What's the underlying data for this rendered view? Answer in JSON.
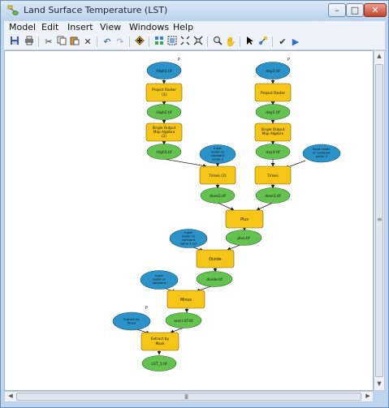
{
  "window": {
    "title": "Land Surface Temperature (LST)"
  },
  "menu": [
    "Model",
    "Edit",
    "Insert",
    "View",
    "Windows",
    "Help"
  ],
  "toolbar": [
    "save-icon",
    "print-icon",
    "cut-icon",
    "copy-icon",
    "paste-icon",
    "delete-icon",
    "undo-icon",
    "redo-icon",
    "add-data-icon",
    "auto-layout-icon",
    "full-extent-icon",
    "fixed-zoom-out-icon",
    "fixed-zoom-in-icon",
    "zoom-icon",
    "pan-icon",
    "select-icon",
    "connect-icon",
    "validate-icon",
    "run-icon"
  ],
  "model": {
    "left_input": "High1.tif",
    "left_project": "Project Raster (3)",
    "left_projected": "High2.tif",
    "left_smoa": "Single Output Map Algebra (2)",
    "left_smoa_out": "High3.tif",
    "left_times_const": "Input raster or constant value 2",
    "left_times": "Times (2)",
    "left_times_out": "dese2.tif",
    "right_input": "day1.tif",
    "right_project": "Project Raster",
    "right_projected": "day2.tif",
    "right_smoa": "Single Output Map Algebra",
    "right_smoa_out": "day3.tif",
    "right_times_const": "Input raster or constant value 2",
    "right_times": "Times",
    "right_times_out": "dese1.tif",
    "plus": "Plus",
    "plus_out": "plus.tif",
    "divide_const": "Input raster or constant value 2 (2)",
    "divide": "Divide",
    "divide_out": "divide.tif",
    "minus_const": "Input raster or constant value",
    "minus": "Minus",
    "minus_out": "and LST.tif",
    "ext_input": "Extract by Mask (input)",
    "ext_tool": "Extract by Mask",
    "ext_out": "LST_1.tif"
  },
  "scroll": {
    "grip": "III"
  }
}
